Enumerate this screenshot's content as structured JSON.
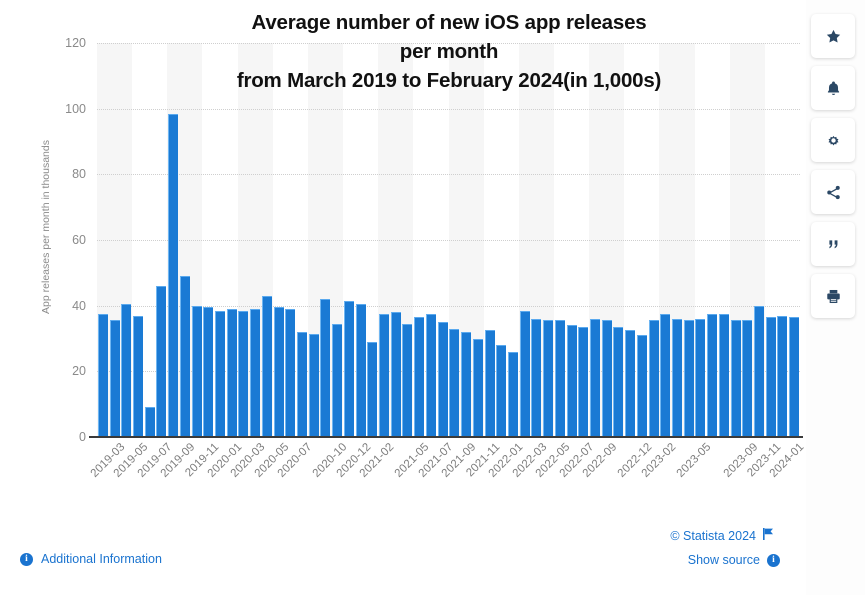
{
  "chart_data": {
    "type": "bar",
    "title": "Average number of new iOS app releases per month from March 2019 to February 2024(in 1,000s)",
    "title_lines": [
      "Average number of new iOS app releases",
      "per month",
      "from March 2019 to February 2024(in 1,000s)"
    ],
    "xlabel": "",
    "ylabel": "App releases per month in thousands",
    "ylim": [
      0,
      120
    ],
    "yticks": [
      0,
      20,
      40,
      60,
      80,
      100,
      120
    ],
    "grid": true,
    "legend": "none",
    "bar_color": "#1a7ad4",
    "categories": [
      "2019-03",
      "2019-04",
      "2019-05",
      "2019-06",
      "2019-07",
      "2019-08",
      "2019-09",
      "2019-10",
      "2019-11",
      "2019-12",
      "2020-01",
      "2020-02",
      "2020-03",
      "2020-04",
      "2020-05",
      "2020-06",
      "2020-07",
      "2020-08",
      "2020-09",
      "2020-10",
      "2020-11",
      "2020-12",
      "2021-01",
      "2021-02",
      "2021-03",
      "2021-04",
      "2021-05",
      "2021-06",
      "2021-07",
      "2021-08",
      "2021-09",
      "2021-10",
      "2021-11",
      "2021-12",
      "2022-01",
      "2022-02",
      "2022-03",
      "2022-04",
      "2022-05",
      "2022-06",
      "2022-07",
      "2022-08",
      "2022-09",
      "2022-10",
      "2022-11",
      "2022-12",
      "2023-01",
      "2023-02",
      "2023-03",
      "2023-04",
      "2023-05",
      "2023-06",
      "2023-07",
      "2023-08",
      "2023-09",
      "2023-10",
      "2023-11",
      "2023-12",
      "2024-01",
      "2024-02"
    ],
    "tick_labels": [
      "2019-03",
      "2019-05",
      "2019-07",
      "2019-09",
      "2019-11",
      "2020-01",
      "2020-03",
      "2020-05",
      "2020-07",
      "2020-10",
      "2020-12",
      "2021-02",
      "2021-05",
      "2021-07",
      "2021-09",
      "2021-11",
      "2022-01",
      "2022-03",
      "2022-05",
      "2022-07",
      "2022-09",
      "2022-12",
      "2023-02",
      "2023-05",
      "2023-09",
      "2023-11",
      "2024-01"
    ],
    "values": [
      37.5,
      35.5,
      40.5,
      37.0,
      9.0,
      46.0,
      98.5,
      49.0,
      40.0,
      39.5,
      38.5,
      39.0,
      38.5,
      39.0,
      43.0,
      39.5,
      39.0,
      32.0,
      31.5,
      42.0,
      34.5,
      41.5,
      40.5,
      29.0,
      37.5,
      38.0,
      34.5,
      36.5,
      37.5,
      35.0,
      33.0,
      32.0,
      30.0,
      32.5,
      28.0,
      26.0,
      38.5,
      36.0,
      35.5,
      35.5,
      34.0,
      33.5,
      36.0,
      35.5,
      33.5,
      32.5,
      31.0,
      35.5,
      37.5,
      36.0,
      35.5,
      36.0,
      37.5,
      37.5,
      35.5,
      35.5,
      40.0,
      36.5,
      37.0,
      36.5
    ]
  },
  "footer": {
    "copyright": "© Statista 2024",
    "show_source": "Show source",
    "additional_information": "Additional Information",
    "info_glyph": "i"
  },
  "toolbar": {
    "items": [
      {
        "name": "favorite-star",
        "label": "Favorite"
      },
      {
        "name": "notification-bell",
        "label": "Notifications"
      },
      {
        "name": "settings-gear",
        "label": "Settings"
      },
      {
        "name": "share",
        "label": "Share"
      },
      {
        "name": "cite-quote",
        "label": "Cite"
      },
      {
        "name": "print",
        "label": "Print"
      }
    ]
  },
  "colors": {
    "bar": "#1a7ad4",
    "link": "#1a73cf",
    "grid": "#cfcfcf",
    "axis": "#3a3a3a",
    "tick_text": "#8a8a8a",
    "toolbar_icon": "#2b4865"
  }
}
